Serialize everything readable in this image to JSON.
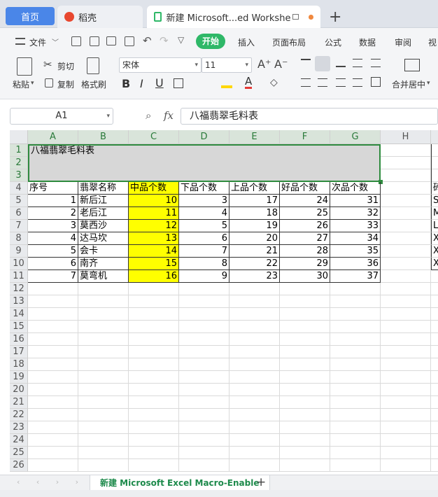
{
  "tabs": {
    "home_label": "首页",
    "wps_label": "稻壳",
    "doc_label": "新建 Microsoft...ed Worksheet",
    "new_tab": "+"
  },
  "menu": {
    "file": "文件",
    "items": [
      "开始",
      "插入",
      "页面布局",
      "公式",
      "数据",
      "审阅",
      "视"
    ]
  },
  "ribbon": {
    "paste": "粘贴",
    "cut": "剪切",
    "copy": "复制",
    "format_painter": "格式刷",
    "font_name": "宋体",
    "font_size": "11",
    "merge_center": "合并居中"
  },
  "formula_bar": {
    "name_box": "A1",
    "fx": "fx",
    "content": "八福翡翠毛料表"
  },
  "sheet": {
    "columns": [
      "A",
      "B",
      "C",
      "D",
      "E",
      "F",
      "G",
      "H",
      ""
    ],
    "rows": [
      "1",
      "2",
      "3",
      "4",
      "5",
      "6",
      "7",
      "8",
      "9",
      "10",
      "11",
      "12",
      "13",
      "14",
      "15",
      "16",
      "17",
      "18",
      "19",
      "20",
      "21",
      "22",
      "23",
      "24",
      "25",
      "26"
    ],
    "title": "八福翡翠毛料表",
    "headers": [
      "序号",
      "翡翠名称",
      "中品个数",
      "下品个数",
      "上品个数",
      "好品个数",
      "次品个数"
    ],
    "data": [
      [
        "1",
        "新后江",
        "10",
        "3",
        "17",
        "24",
        "31"
      ],
      [
        "2",
        "老后江",
        "11",
        "4",
        "18",
        "25",
        "32"
      ],
      [
        "3",
        "莫西沙",
        "12",
        "5",
        "19",
        "26",
        "33"
      ],
      [
        "4",
        "达马坎",
        "13",
        "6",
        "20",
        "27",
        "34"
      ],
      [
        "5",
        "会卡",
        "14",
        "7",
        "21",
        "28",
        "35"
      ],
      [
        "6",
        "南齐",
        "15",
        "8",
        "22",
        "29",
        "36"
      ],
      [
        "7",
        "莫弯机",
        "16",
        "9",
        "23",
        "30",
        "37"
      ]
    ],
    "col_i_partial": [
      "砖",
      "S",
      "M",
      "L",
      "X",
      "X",
      "X"
    ]
  },
  "sheet_tab": {
    "name": "新建 Microsoft Excel Macro-Enable",
    "add": "+"
  },
  "colors": {
    "accent_green": "#2fb868",
    "highlight_yellow": "#ffff00",
    "selection_green": "#2e8b3e"
  }
}
